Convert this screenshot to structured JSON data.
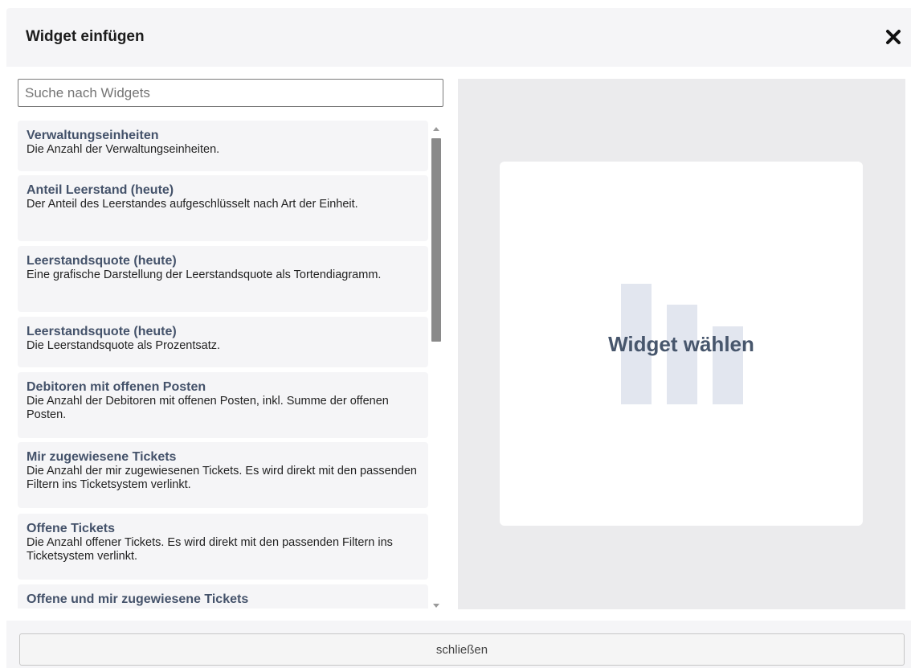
{
  "dialog": {
    "title": "Widget einfügen",
    "close_icon": "close-icon"
  },
  "search": {
    "placeholder": "Suche nach Widgets",
    "value": ""
  },
  "widgets": [
    {
      "title": "Verwaltungseinheiten",
      "description": "Die Anzahl der Verwaltungseinheiten."
    },
    {
      "title": "Anteil Leerstand (heute)",
      "description": "Der Anteil des Leerstandes aufgeschlüsselt nach Art der Einheit."
    },
    {
      "title": "Leerstandsquote (heute)",
      "description": "Eine grafische Darstellung der Leerstandsquote als Tortendiagramm."
    },
    {
      "title": "Leerstandsquote (heute)",
      "description": "Die Leerstandsquote als Prozentsatz."
    },
    {
      "title": "Debitoren mit offenen Posten",
      "description": "Die Anzahl der Debitoren mit offenen Posten, inkl. Summe der offenen Posten."
    },
    {
      "title": "Mir zugewiesene Tickets",
      "description": "Die Anzahl der mir zugewiesenen Tickets. Es wird direkt mit den passenden Filtern ins Ticketsystem verlinkt."
    },
    {
      "title": "Offene Tickets",
      "description": "Die Anzahl offener Tickets. Es wird direkt mit den passenden Filtern ins Ticketsystem verlinkt."
    },
    {
      "title": "Offene und mir zugewiesene Tickets",
      "description": ""
    }
  ],
  "preview": {
    "placeholder_text": "Widget wählen",
    "icon": "bar-chart-icon"
  },
  "footer": {
    "close_label": "schließen"
  }
}
